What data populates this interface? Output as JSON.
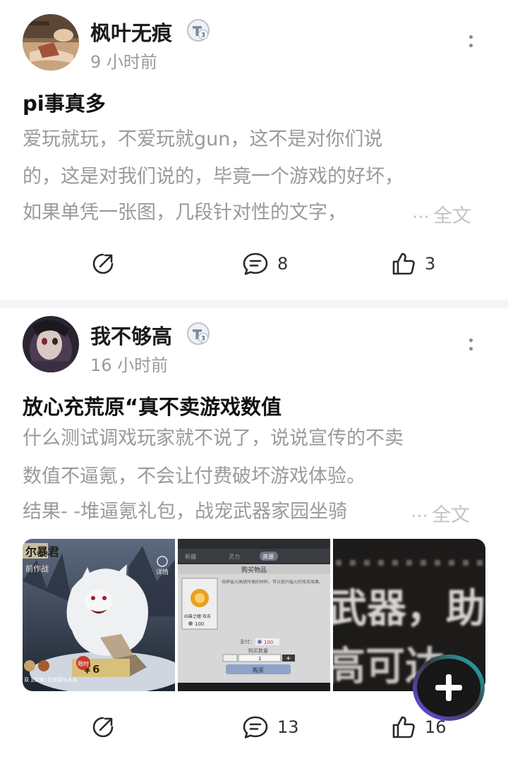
{
  "posts": [
    {
      "username": "枫叶无痕",
      "level": "3",
      "time": "9 小时前",
      "title": "pi事真多",
      "body_lines": [
        "爱玩就玩，不爱玩就gun，这不是对你们说",
        "的，这是对我们说的，毕竟一个游戏的好坏，",
        "如果单凭一张图，几段针对性的文字，"
      ],
      "ellipsis": "...",
      "full_text_label": "全文",
      "share_icon": "share-icon",
      "comment_count": "8",
      "like_count": "3"
    },
    {
      "username": "我不够高",
      "level": "3",
      "time": "16 小时前",
      "title": "放心充荒原“真不卖游戏数值",
      "body_lines": [
        "什么测试调戏玩家就不说了，说说宣传的不卖",
        "数值不逼氪，不会让付费破坏游戏体验。",
        "结果- -堆逼氪礼包，战宠武器家园坐骑"
      ],
      "ellipsis": "...",
      "full_text_label": "全文",
      "images": {
        "img1": {
          "banner": "尔暴君",
          "subtitle": "前作战",
          "side_label": "详情",
          "price_badge": "限时",
          "price": "￥6",
          "bottom_label": "忍痛",
          "bottom_left": "双 ][友族] 及其腐化水泉"
        },
        "img2": {
          "tabs": [
            "新疆",
            "灵力",
            "资源"
          ],
          "dialog_title": "购买物品",
          "desc": "培养猛火高级所需的材料，可以提升猛火的攻击效果。",
          "item_name": "凶兽之瞳·攻击",
          "item_price": "100",
          "pay_label": "支付：",
          "pay_amount": "100",
          "qty_label": "购买数量",
          "qty_value": "1",
          "buy_button": "购买"
        },
        "img3": {
          "text_top": "武器，助",
          "text_bottom": "高可达"
        }
      },
      "share_icon": "share-icon",
      "comment_count": "13",
      "like_count": "16"
    }
  ],
  "colors": {
    "text_primary": "#1a1a1a",
    "text_body": "#9a9a9a",
    "text_muted": "#c4c4c4",
    "badge_ring": "#b9c3cf",
    "fab_bg": "#171717",
    "fab_ring_gradient": [
      "#6b4bff",
      "#1ec9d6"
    ]
  }
}
